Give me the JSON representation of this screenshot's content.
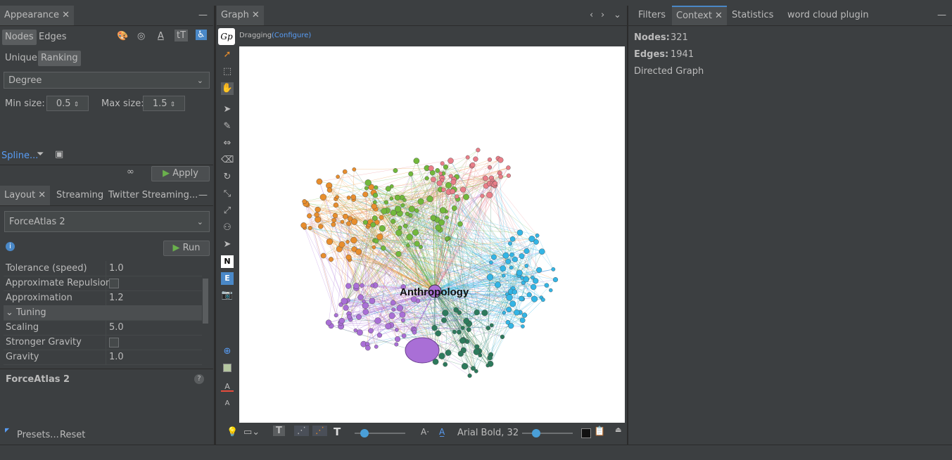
{
  "appearance": {
    "tab": "Appearance",
    "nodes_label": "Nodes",
    "edges_label": "Edges",
    "unique_label": "Unique",
    "ranking_label": "Ranking",
    "attribute": "Degree",
    "min_size_label": "Min size:",
    "min_size": "0.5",
    "max_size_label": "Max size:",
    "max_size": "1.5",
    "spline_label": "Spline...",
    "infinity": "∞",
    "apply_label": "Apply"
  },
  "layout": {
    "tabs": [
      "Layout",
      "Streaming",
      "Twitter Streaming..."
    ],
    "algorithm": "ForceAtlas 2",
    "run_label": "Run",
    "properties": [
      {
        "key": "Tolerance (speed)",
        "value": "1.0"
      },
      {
        "key": "Approximate Repulsion",
        "value": ""
      },
      {
        "key": "Approximation",
        "value": "1.2"
      },
      {
        "key": "Tuning",
        "value": ""
      },
      {
        "key": "Scaling",
        "value": "5.0"
      },
      {
        "key": "Stronger Gravity",
        "value": ""
      },
      {
        "key": "Gravity",
        "value": "1.0"
      }
    ],
    "description_title": "ForceAtlas 2",
    "presets_label": "Presets...",
    "reset_label": "Reset"
  },
  "graph": {
    "tab": "Graph",
    "mode": "Dragging",
    "configure": "(Configure)",
    "center_label": "Anthropology",
    "font_label": "Arial Bold, 32",
    "cluster_colors": [
      "#a96fd6",
      "#e88e2d",
      "#72b83b",
      "#e97e88",
      "#33b5e5",
      "#2d7a5c"
    ]
  },
  "right": {
    "tabs": [
      "Filters",
      "Context",
      "Statistics",
      "word cloud plugin"
    ],
    "nodes_label": "Nodes:",
    "nodes_value": "321",
    "edges_label": "Edges:",
    "edges_value": "1941",
    "graph_type": "Directed Graph"
  }
}
